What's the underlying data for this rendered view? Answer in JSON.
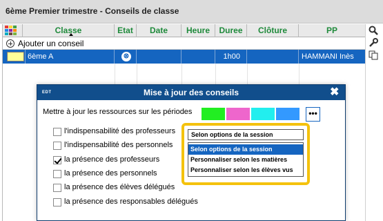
{
  "window": {
    "title": "6ème Premier trimestre - Conseils de classe"
  },
  "grid": {
    "columns": [
      "Classe",
      "Etat",
      "Date",
      "Heure",
      "Duree",
      "Clôture",
      "PP"
    ],
    "add_label": "Ajouter un conseil",
    "rows": [
      {
        "classe": "6ème A",
        "etat": "⊗",
        "date": "",
        "heure": "",
        "duree": "1h00",
        "cloture": "",
        "pp": "HAMMANI Inès",
        "color": "#ffff99"
      }
    ]
  },
  "toolbar": {
    "icons": [
      "search-icon",
      "wrench-icon",
      "copy-icon"
    ]
  },
  "dialog": {
    "app_tag": "EDT",
    "title": "Mise à jour des conseils",
    "close_label": "✖",
    "periods_label": "Mettre à jour les ressources sur les périodes",
    "period_colors": [
      "#22ee22",
      "#ee66cc",
      "#22eeee",
      "#3399ff"
    ],
    "more_label": "•••",
    "options": [
      {
        "label": "l'indispensabilité des professeurs",
        "checked": false
      },
      {
        "label": "l'indispensabilité des personnels",
        "checked": false
      },
      {
        "label": "la présence des professeurs",
        "checked": true
      },
      {
        "label": "la présence des personnels",
        "checked": false
      },
      {
        "label": "la présence des élèves délégués",
        "checked": false
      },
      {
        "label": "la présence des responsables délégués",
        "checked": false
      }
    ],
    "dropdown": {
      "selected": "Selon options de la session",
      "options": [
        "Selon options de la session",
        "Personnaliser selon les matières",
        "Personnaliser selon les élèves vus"
      ],
      "highlight_color": "#f4c20d"
    }
  }
}
